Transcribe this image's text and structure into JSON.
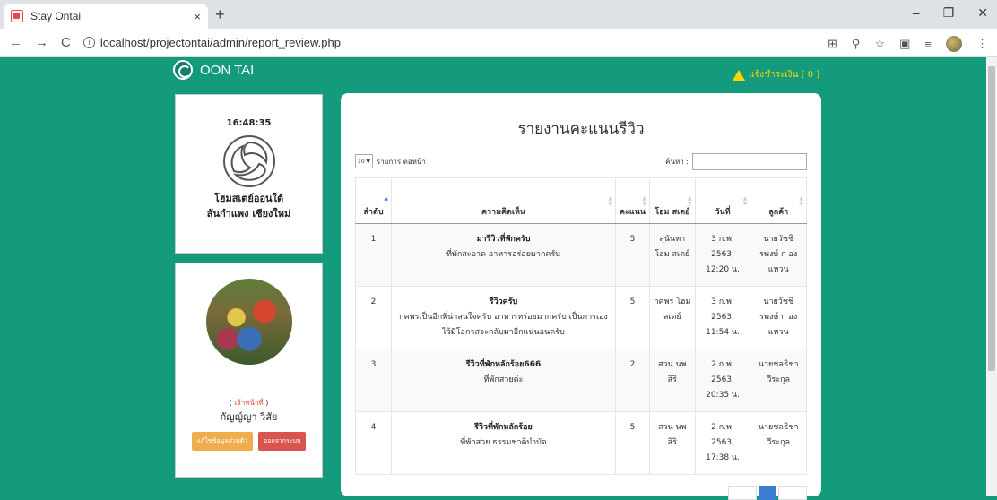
{
  "browser": {
    "tab_title": "Stay Ontai",
    "url": "localhost/projectontai/admin/report_review.php",
    "new_tab": "+",
    "close": "×"
  },
  "header": {
    "brand": "OON TAI",
    "notice": "แจ้งชำระเงิน [ 0 ]"
  },
  "sidebar": {
    "clock": "16:48:35",
    "hotel_name": "โฮมสเตย์ออนใต้",
    "hotel_location": "สันกำแพง เชียงใหม่",
    "role": "เจ้าหน้าที่",
    "user": "กัญญ์ญา วิสัย",
    "edit_button": "แก้ไขข้อมูลส่วนตัว",
    "logout_button": "ออกจากระบบ"
  },
  "main": {
    "title": "รายงานคะแนนรีวิว",
    "length_value": "10",
    "length_label": "รายการ ต่อหน้า",
    "search_label": "ค้นหา :",
    "columns": [
      "ลำดับ",
      "ความคิดเห็น",
      "คะแนน",
      "โฮม สเตย์",
      "วันที่",
      "ลูกค้า"
    ],
    "rows": [
      {
        "no": "1",
        "title": "มารีวิวที่พักครับ",
        "body": "ที่พักสะอาด อาหารอร่อยมากครับ",
        "score": "5",
        "home": "สุนันทา โฮม สเตย์",
        "date": "3 ก.พ. 2563, 12:20 น.",
        "customer": "นายวัชชิ รพงษ์ ก องแหวน"
      },
      {
        "no": "2",
        "title": "รีวิวครับ",
        "body": "กคพรเป็นอีกที่น่าสนใจครับ อาหารหร่อยมากครับ เป็นการเองไว้มีโอกาสจะกลับมาอีกแน่นอนครับ",
        "score": "5",
        "home": "กคพร โฮม สเตย์",
        "date": "3 ก.พ. 2563, 11:54 น.",
        "customer": "นายวัชชิ รพงษ์ ก องแหวน"
      },
      {
        "no": "3",
        "title": "รีวิวที่พักหลักร้อย666",
        "body": "ที่พักสวยค่ะ",
        "score": "2",
        "home": "สวน นพสิริ",
        "date": "2 ก.พ. 2563, 20:35 น.",
        "customer": "นายชลธิชา วีระกุล"
      },
      {
        "no": "4",
        "title": "รีวิวที่พักหลักร้อย",
        "body": "ที่พักสวย ธรรมชาติบำบัด",
        "score": "5",
        "home": "สวน นพสิริ",
        "date": "2 ก.พ. 2563, 17:38 น.",
        "customer": "นายชลธิชา วีระกุล"
      }
    ]
  }
}
